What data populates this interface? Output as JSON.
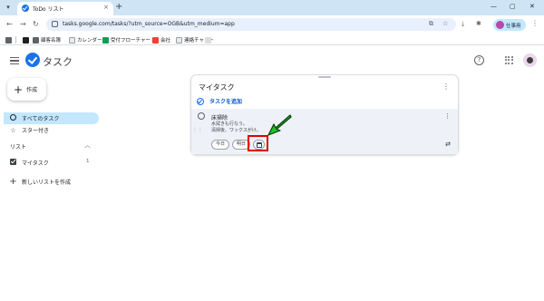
{
  "browser": {
    "tab_title": "ToDo リスト",
    "tab_close": "×",
    "new_tab": "+",
    "window_controls": [
      "—",
      "▢",
      "✕"
    ],
    "url": "tasks.google.com/tasks/?utm_source=OGB&utm_medium=app",
    "profile_label": "仕事用",
    "bookmarks": [
      "顧客名簿",
      "カレンダー",
      "受付フローチャート",
      "会社",
      "連絡チャット"
    ]
  },
  "app": {
    "name": "タスク",
    "help": "?"
  },
  "sidebar": {
    "create_label": "作成",
    "create_icon": "+",
    "all_tasks": "すべてのタスク",
    "starred": "スター付き",
    "star_icon": "☆",
    "lists_heading": "リスト",
    "list_name": "マイタスク",
    "list_count": "1",
    "new_list": "新しいリストを作成",
    "new_list_icon": "+"
  },
  "card": {
    "title": "マイタスク",
    "add_task": "タスクを追加",
    "task": {
      "name": "床掃除",
      "notes": [
        "水拭きも行なう。",
        "清掃後、ワックスがけ。"
      ],
      "chip_today": "今日",
      "chip_tomorrow": "明日"
    }
  },
  "colors": {
    "accent": "#1a73e8",
    "highlight": "#e00000",
    "arrow": "#22c02a"
  }
}
